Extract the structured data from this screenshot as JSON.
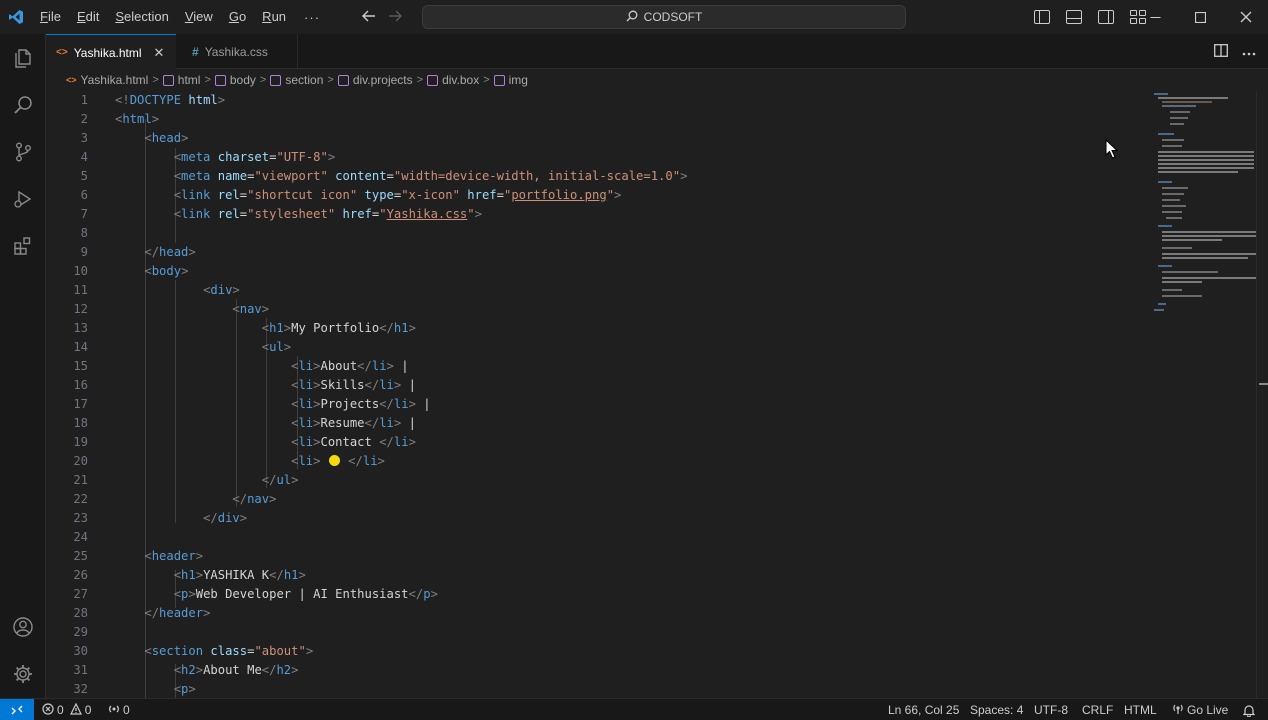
{
  "titlebar": {
    "menu": [
      "File",
      "Edit",
      "Selection",
      "View",
      "Go",
      "Run"
    ],
    "more": "···",
    "search_text": "CODSOFT"
  },
  "tabs": [
    {
      "label": "Yashika.html",
      "icon": "html-file-icon",
      "active": true,
      "close": "✕"
    },
    {
      "label": "Yashika.css",
      "icon": "css-file-icon",
      "active": false
    }
  ],
  "breadcrumb": [
    "Yashika.html",
    "html",
    "body",
    "section",
    "div.projects",
    "div.box",
    "img"
  ],
  "editor": {
    "lines": [
      {
        "n": "1"
      },
      {
        "n": "2"
      },
      {
        "n": "3"
      },
      {
        "n": "4"
      },
      {
        "n": "5"
      },
      {
        "n": "6"
      },
      {
        "n": "7"
      },
      {
        "n": "8"
      },
      {
        "n": "9"
      },
      {
        "n": "10"
      },
      {
        "n": "11"
      },
      {
        "n": "12"
      },
      {
        "n": "13"
      },
      {
        "n": "14"
      },
      {
        "n": "15"
      },
      {
        "n": "16"
      },
      {
        "n": "17"
      },
      {
        "n": "18"
      },
      {
        "n": "19"
      },
      {
        "n": "20"
      },
      {
        "n": "21"
      },
      {
        "n": "22"
      },
      {
        "n": "23"
      },
      {
        "n": "24"
      },
      {
        "n": "25"
      },
      {
        "n": "26"
      },
      {
        "n": "27"
      },
      {
        "n": "28"
      },
      {
        "n": "29"
      },
      {
        "n": "30"
      },
      {
        "n": "31"
      },
      {
        "n": "32"
      }
    ]
  },
  "statusbar": {
    "errors": "0",
    "warnings": "0",
    "ports": "0",
    "position": "Ln 66, Col 25",
    "spaces": "Spaces: 4",
    "encoding": "UTF-8",
    "eol": "CRLF",
    "language": "HTML",
    "golive": "Go Live"
  },
  "colors": {
    "accent": "#0078d4",
    "tag": "#569cd6",
    "attribute": "#9cdcfe",
    "string": "#ce9178",
    "text": "#d4d4d4"
  }
}
